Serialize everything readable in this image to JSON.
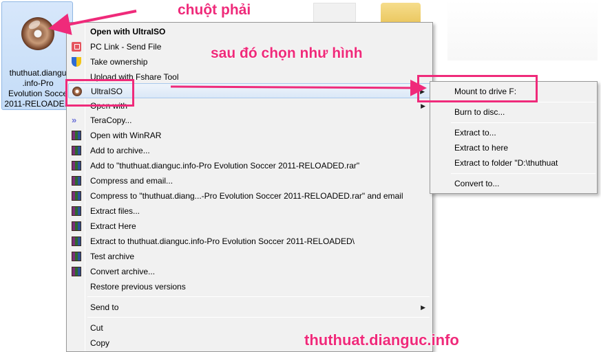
{
  "desktop": {
    "file_name_lines": [
      ".info-Pro",
      "Evolution Socce",
      "2011-RELOADE..."
    ],
    "file_name_first": "thuthuat.diangu"
  },
  "annotations": {
    "right_click": "chuột phải",
    "then_choose": "sau đó chọn như hình",
    "watermark": "thuthuat.dianguc.info",
    "color": "#ef2a7a"
  },
  "context_menu": {
    "items": [
      {
        "label": "Open with UltraISO",
        "icon": "none",
        "bold": true
      },
      {
        "label": "PC Link - Send File",
        "icon": "pc-link-icon"
      },
      {
        "label": "Take ownership",
        "icon": "shield-icon"
      },
      {
        "label": "Upload with Fshare Tool",
        "icon": "none"
      },
      {
        "label": "UltraISO",
        "icon": "ultraiso-icon",
        "submenu": true,
        "highlighted": true
      },
      {
        "label": "Open with",
        "icon": "none",
        "submenu": true
      },
      {
        "label": "TeraCopy...",
        "icon": "teracopy-icon"
      },
      {
        "label": "Open with WinRAR",
        "icon": "winrar-icon"
      },
      {
        "label": "Add to archive...",
        "icon": "winrar-icon"
      },
      {
        "label": "Add to \"thuthuat.dianguc.info-Pro Evolution Soccer 2011-RELOADED.rar\"",
        "icon": "winrar-icon"
      },
      {
        "label": "Compress and email...",
        "icon": "winrar-icon"
      },
      {
        "label": "Compress to \"thuthuat.diang...-Pro Evolution Soccer 2011-RELOADED.rar\" and email",
        "icon": "winrar-icon"
      },
      {
        "label": "Extract files...",
        "icon": "winrar-icon"
      },
      {
        "label": "Extract Here",
        "icon": "winrar-icon"
      },
      {
        "label": "Extract to thuthuat.dianguc.info-Pro Evolution Soccer 2011-RELOADED\\",
        "icon": "winrar-icon"
      },
      {
        "label": "Test archive",
        "icon": "winrar-icon"
      },
      {
        "label": "Convert archive...",
        "icon": "winrar-icon"
      },
      {
        "label": "Restore previous versions",
        "icon": "none"
      },
      {
        "label": "Send to",
        "icon": "none",
        "submenu": true
      },
      {
        "label": "Cut",
        "icon": "none"
      },
      {
        "label": "Copy",
        "icon": "none"
      }
    ]
  },
  "submenu": {
    "items": [
      {
        "label": "Mount to drive F:"
      },
      {
        "label": "Burn to disc..."
      },
      {
        "label": "Extract to..."
      },
      {
        "label": "Extract to here"
      },
      {
        "label": "Extract to folder \"D:\\thuthuat"
      },
      {
        "label": "Convert to..."
      }
    ]
  }
}
